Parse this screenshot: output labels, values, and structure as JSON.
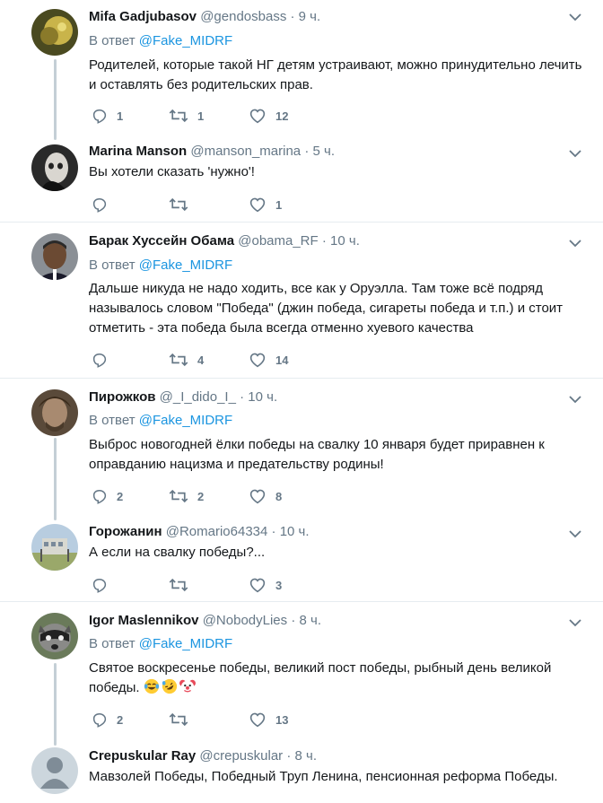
{
  "tweets": [
    {
      "name": "Mifa Gadjubasov",
      "handle": "@gendosbass",
      "dot": "·",
      "time": "9 ч.",
      "reply_prefix": "В ответ",
      "reply_to": "@Fake_MIDRF",
      "text": "Родителей, которые такой НГ детям устраивают, можно принудительно лечить и оставлять без родительских прав.",
      "replies": "1",
      "retweets": "1",
      "likes": "12"
    },
    {
      "name": "Marina Manson",
      "handle": "@manson_marina",
      "dot": "·",
      "time": "5 ч.",
      "text": "Вы хотели сказать 'нужно'!",
      "replies": "",
      "retweets": "",
      "likes": "1"
    },
    {
      "name": "Барак Хуссейн Обама",
      "handle": "@obama_RF",
      "dot": "·",
      "time": "10 ч.",
      "reply_prefix": "В ответ",
      "reply_to": "@Fake_MIDRF",
      "text": "Дальше никуда не надо ходить, все как у Оруэлла. Там тоже всё подряд называлось словом \"Победа\" (джин победа, сигареты победа и т.п.) и стоит отметить - эта победа была всегда отменно хуевого качества",
      "replies": "",
      "retweets": "4",
      "likes": "14"
    },
    {
      "name": "Пирожков",
      "handle": "@_I_dido_I_",
      "dot": "·",
      "time": "10 ч.",
      "reply_prefix": "В ответ",
      "reply_to": "@Fake_MIDRF",
      "text": "Выброс новогодней ёлки победы на свалку 10 января будет приравнен к оправданию нацизма и предательству родины!",
      "replies": "2",
      "retweets": "2",
      "likes": "8"
    },
    {
      "name": "Горожанин",
      "handle": "@Romario64334",
      "dot": "·",
      "time": "10 ч.",
      "text": "А если на свалку победы?...",
      "replies": "",
      "retweets": "",
      "likes": "3"
    },
    {
      "name": "Igor Maslennikov",
      "handle": "@NobodyLies",
      "dot": "·",
      "time": "8 ч.",
      "reply_prefix": "В ответ",
      "reply_to": "@Fake_MIDRF",
      "text": "Святое воскресенье победы, великий пост победы, рыбный день великой победы.",
      "emojis": [
        "face-with-tears-of-joy",
        "rolling-on-floor-laughing",
        "clown-face"
      ],
      "replies": "2",
      "retweets": "",
      "likes": "13"
    },
    {
      "name": "Crepuskular Ray",
      "handle": "@crepuskular",
      "dot": "·",
      "time": "8 ч.",
      "text": "Мавзолей Победы, Победный Труп Ленина, пенсионная реформа Победы."
    }
  ],
  "colors": {
    "name": "#14171a",
    "muted": "#657786",
    "link": "#1b95e0",
    "divider": "#e6ecf0",
    "thread_line": "#c4cfd6"
  },
  "icons": {
    "reply": "reply-icon",
    "retweet": "retweet-icon",
    "like": "heart-icon",
    "more": "chevron-down-icon"
  }
}
